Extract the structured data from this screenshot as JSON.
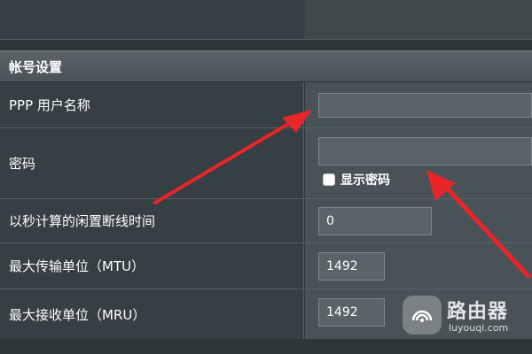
{
  "section": {
    "title": "帐号设置"
  },
  "fields": {
    "ppp_username": {
      "label": "PPP 用户名称",
      "value": ""
    },
    "password": {
      "label": "密码",
      "value": "",
      "show_password_label": "显示密码"
    },
    "idle_timeout": {
      "label": "以秒计算的闲置断线时间",
      "value": "0"
    },
    "mtu": {
      "label": "最大传输单位（MTU）",
      "value": "1492"
    },
    "mru": {
      "label": "最大接收单位（MRU）",
      "value": "1492"
    }
  },
  "watermark": {
    "text": "路由器",
    "sub": "luyouqi.com"
  },
  "colors": {
    "arrow": "#e8262a",
    "section_header": "#525b5f",
    "label_bg": "#363f43",
    "value_bg": "#495357"
  }
}
